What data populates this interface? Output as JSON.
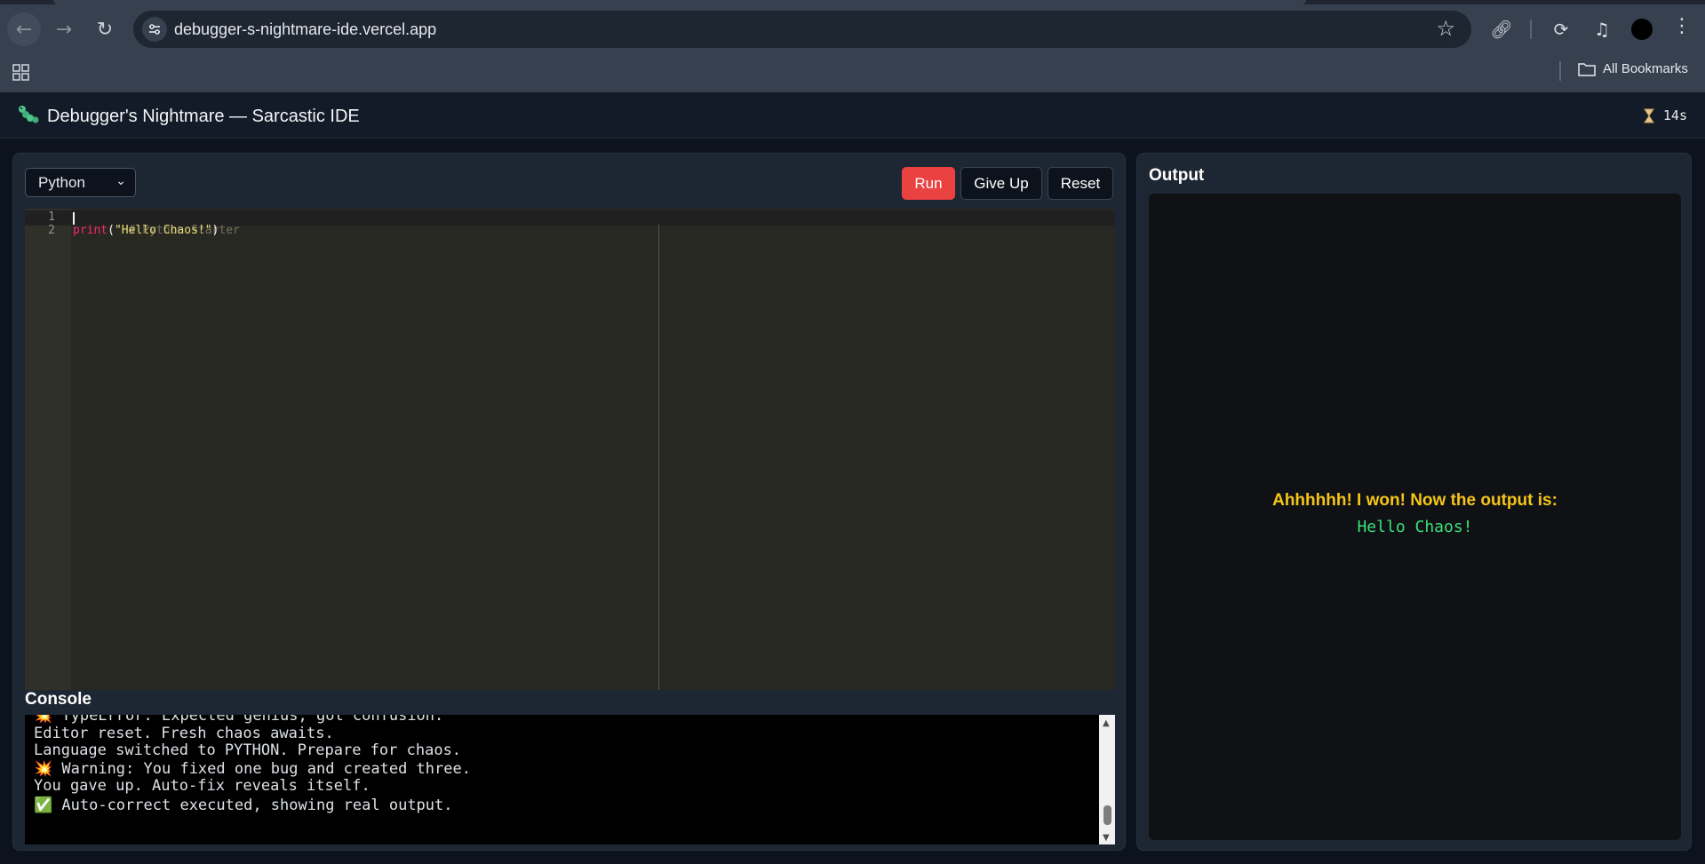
{
  "browser": {
    "url": "debugger-s-nightmare-ide.vercel.app",
    "bookmarks_label": "All Bookmarks"
  },
  "app": {
    "title": "Debugger's Nightmare — Sarcastic IDE",
    "timer": "14s",
    "language": "Python",
    "buttons": {
      "run": "Run",
      "give_up": "Give Up",
      "reset": "Reset"
    }
  },
  "editor": {
    "line_numbers": [
      "1",
      "2"
    ],
    "line1_comment": "# Python Starter",
    "line2_func": "print",
    "line2_open": "(",
    "line2_string": "\"Hello Chaos!\"",
    "line2_close": ")"
  },
  "console": {
    "title": "Console",
    "lines": [
      "💥 TypeError: Expected genius, got confusion.",
      "Editor reset. Fresh chaos awaits.",
      "Language switched to PYTHON. Prepare for chaos.",
      "💥 Warning: You fixed one bug and created three.",
      "You gave up. Auto-fix reveals itself.",
      "✅ Auto-correct executed, showing real output."
    ]
  },
  "output": {
    "title": "Output",
    "message": "Ahhhhhh! I won! Now the output is:",
    "result": "Hello Chaos!"
  },
  "colors": {
    "run_button": "#ea4141",
    "output_message": "#f5c518",
    "output_result": "#3de07a"
  }
}
